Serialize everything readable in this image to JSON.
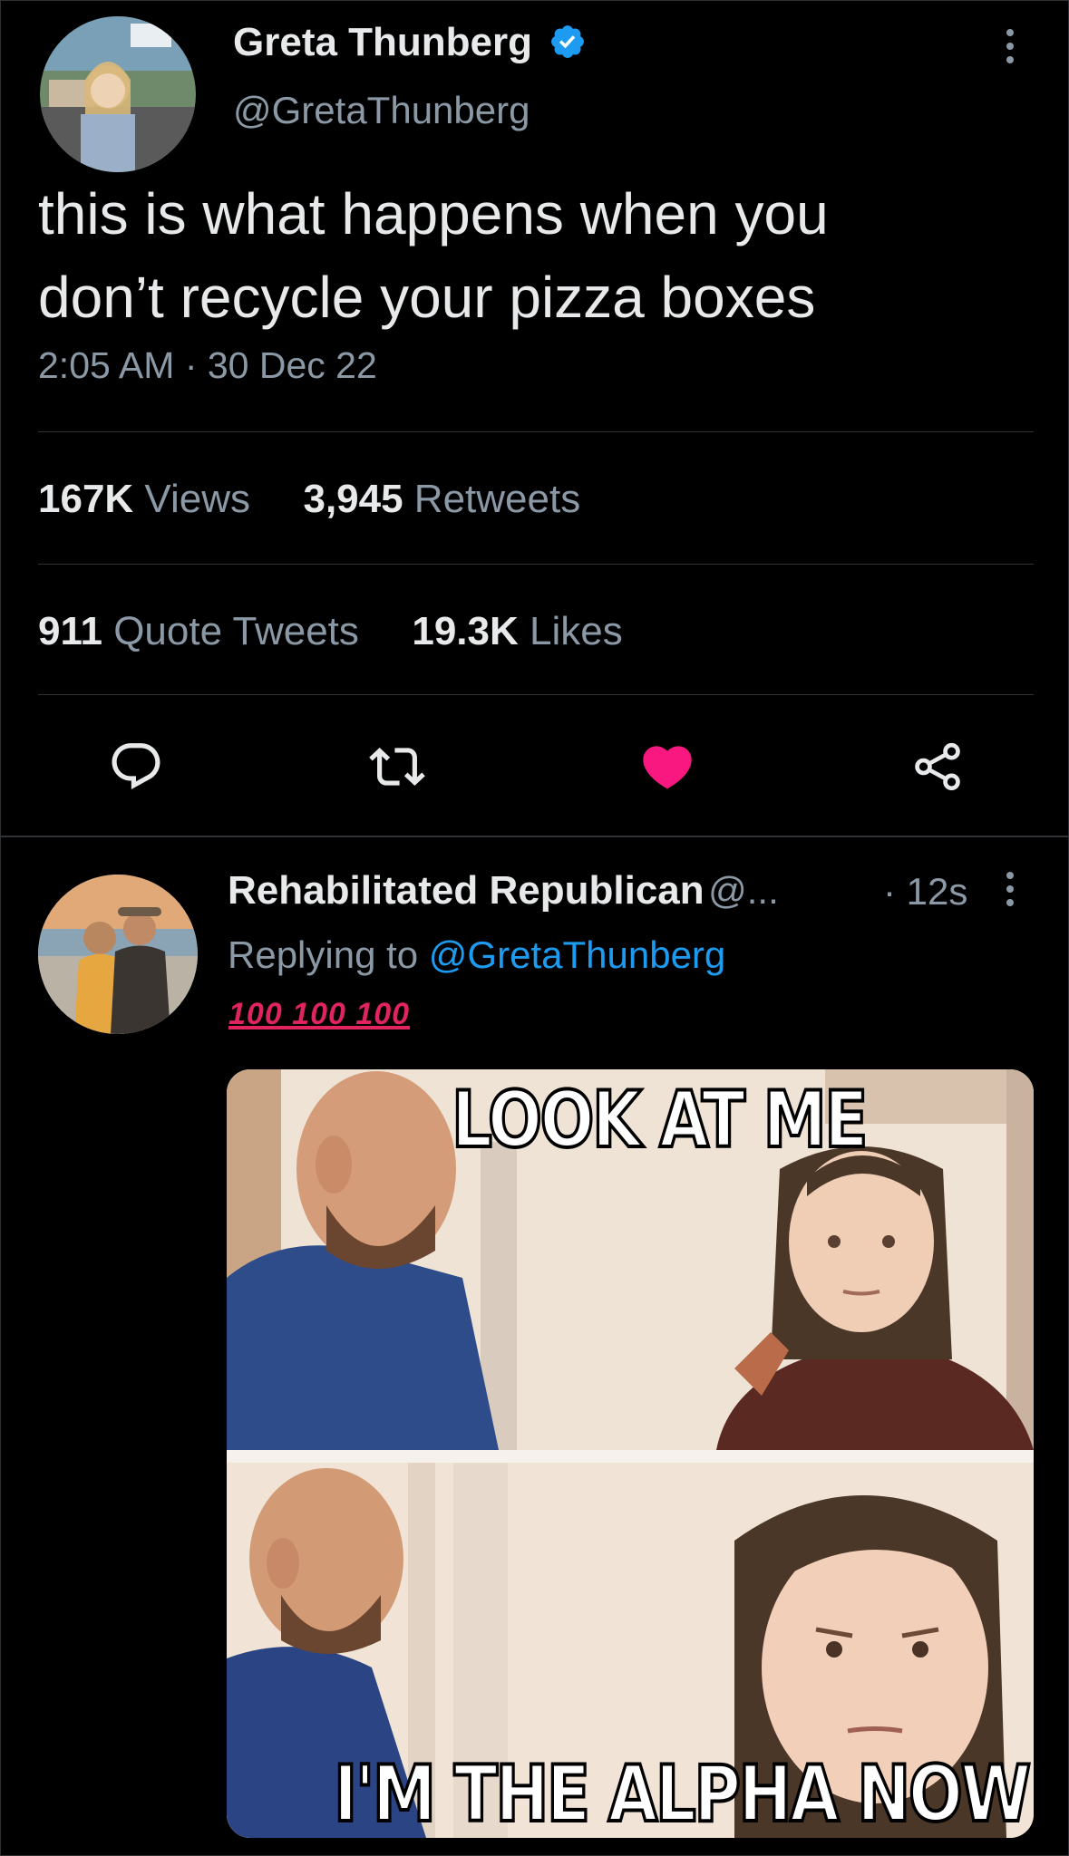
{
  "tweet": {
    "author_name": "Greta Thunberg",
    "author_handle": "@GretaThunberg",
    "text_line1": "this is what happens when you",
    "text_line2": "don’t recycle your pizza boxes",
    "time": "2:05 AM",
    "separator": " · ",
    "date": "30 Dec 22",
    "stats": {
      "views_count": "167K",
      "views_label": " Views",
      "retweets_count": "3,945",
      "retweets_label": " Retweets",
      "quotes_count": "911",
      "quotes_label": " Quote Tweets",
      "likes_count": "19.3K",
      "likes_label": " Likes"
    },
    "actions": {
      "reply_icon": "reply-icon",
      "retweet_icon": "retweet-icon",
      "like_icon": "heart-filled-icon",
      "share_icon": "share-icon"
    },
    "like_color": "#f91880",
    "verified_color": "#1d9bf0"
  },
  "reply": {
    "author_name": "Rehabilitated Republican",
    "author_handle": "@...",
    "time": "· 12s",
    "replying_prefix": "Replying to ",
    "replying_handle": "@GretaThunberg",
    "emoji_text": "100 100 100",
    "meme_top": "LOOK AT ME",
    "meme_bottom": "I'M THE ALPHA NOW"
  }
}
